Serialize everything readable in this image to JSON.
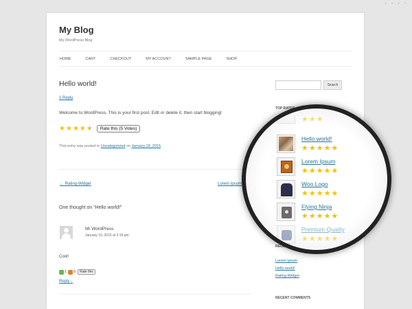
{
  "site": {
    "title": "My Blog",
    "description": "My WordPress Blog"
  },
  "nav": [
    "HOME",
    "CART",
    "CHECKOUT",
    "MY ACCOUNT",
    "SAMPLE PAGE",
    "SHOP"
  ],
  "post": {
    "title": "Hello world!",
    "reply_link": "1 Reply",
    "body": "Welcome to WordPress. This is your first post. Edit or delete it, then start blogging!",
    "rating_stars": 4.5,
    "rate_button": "Rate this (5 Votes)",
    "meta_prefix": "This entry was posted in",
    "meta_category": "Uncategorized",
    "meta_on": "on",
    "meta_date": "January 19, 2015",
    "meta_end": "."
  },
  "post_nav": {
    "prev": "← Rating-Widget",
    "next": "Lorem Ipsum"
  },
  "comments": {
    "title": "One thought on “Hello world!”",
    "author": "Mr WordPress",
    "date": "January 19, 2015 at 2:16 pm",
    "text": "Cool!",
    "likes": "1",
    "dislikes": "0",
    "rate_button": "Rate this",
    "reply": "Reply ↓"
  },
  "sidebar": {
    "search_placeholder": "",
    "search_button": "Search",
    "top_rated_title": "TOP RATED",
    "recent_posts_title": "RECENT POSTS",
    "recent_posts": [
      "Lorem Ipsum",
      "Hello world!",
      "Rating-Widget"
    ],
    "recent_comments_title": "RECENT COMMENTS"
  },
  "magnifier": {
    "items": [
      {
        "title": "Hello world!",
        "stars": 5,
        "icon": "poster-thumbnail"
      },
      {
        "title": "Lorem Ipsum",
        "stars": 5,
        "icon": "box-thumbnail"
      },
      {
        "title": "Woo Logo",
        "stars": 5,
        "icon": "hoodie-thumbnail"
      },
      {
        "title": "Flying Ninja",
        "stars": 5,
        "icon": "shirt-thumbnail"
      },
      {
        "title": "Premium Quality",
        "stars": 5,
        "icon": "quality-thumbnail"
      }
    ]
  },
  "colors": {
    "link": "#21759b",
    "star": "#f2c200",
    "background": "#e6e6e6"
  }
}
